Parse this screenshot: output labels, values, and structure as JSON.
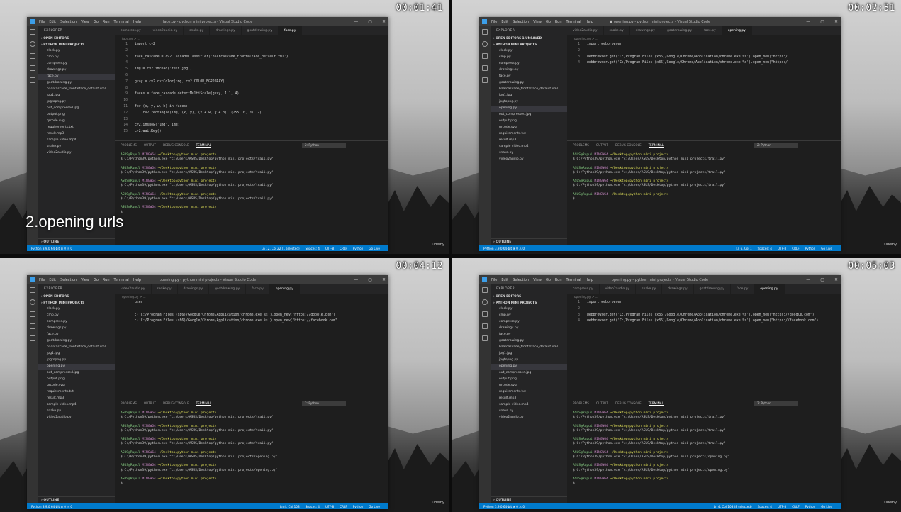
{
  "quads": [
    {
      "timestamp": "00:01:41",
      "caption": "2.opening urls",
      "window_title": "face.py - python mini projects - Visual Studio Code",
      "menu": [
        "File",
        "Edit",
        "Selection",
        "View",
        "Go",
        "Run",
        "Terminal",
        "Help"
      ],
      "explorer": "EXPLORER",
      "sections": [
        "OPEN EDITORS",
        "PYTHON MINI PROJECTS"
      ],
      "files": [
        "clock.py",
        "cmp.py",
        "compress.py",
        "drawings.py",
        "face.py",
        "goatdrawing.py",
        "haarcascade_frontalface_default.xml",
        "jpg1.jpg",
        "jpgtopng.py",
        "out_compressed.jpg",
        "output.png",
        "qrcode.svg",
        "requirements.txt",
        "result.mp3",
        "sample video.mp4",
        "snake.py",
        "video2audio.py"
      ],
      "selected": "face.py",
      "tabs": [
        "compress.py",
        "video2audio.py",
        "snake.py",
        "drawings.py",
        "goatdrawing.py",
        "face.py"
      ],
      "active_tab": "face.py",
      "crumb": "face.py > ...",
      "code": [
        [
          "1",
          "import cv2"
        ],
        [
          "2",
          ""
        ],
        [
          "3",
          "face_cascade = cv2.CascadeClassifier('haarcascade_frontalface_default.xml')"
        ],
        [
          "4",
          ""
        ],
        [
          "5",
          "img = cv2.imread('test.jpg')"
        ],
        [
          "6",
          ""
        ],
        [
          "7",
          "gray = cv2.cvtColor(img, cv2.COLOR_BGR2GRAY)"
        ],
        [
          "8",
          ""
        ],
        [
          "9",
          "faces = face_cascade.detectMultiScale(gray, 1.1, 4)"
        ],
        [
          "10",
          ""
        ],
        [
          "11",
          "for (x, y, w, h) in faces:"
        ],
        [
          "12",
          "    cv2.rectangle(img, (x, y), (x + w, y + h), (255, 0, 0), 2)"
        ],
        [
          "13",
          ""
        ],
        [
          "14",
          "cv2.imshow('img', img)"
        ],
        [
          "15",
          "cv2.waitKey()"
        ]
      ],
      "panel_tabs": [
        "PROBLEMS",
        "OUTPUT",
        "DEBUG CONSOLE",
        "TERMINAL"
      ],
      "terminal_select": "2: Python",
      "terminal": [
        [
          "ASUS@Rupul MINGW64 ~/Desktop/python mini projects",
          "$ C:/Python39/python.exe \"c:/Users/ASUS/Desktop/python mini projects/trail.py\""
        ],
        [
          "ASUS@Rupul MINGW64 ~/Desktop/python mini projects",
          "$ C:/Python39/python.exe \"c:/Users/ASUS/Desktop/python mini projects/trail.py\""
        ],
        [
          "ASUS@Rupul MINGW64 ~/Desktop/python mini projects",
          "$ C:/Python39/python.exe \"c:/Users/ASUS/Desktop/python mini projects/trail.py\""
        ],
        [
          "ASUS@Rupul MINGW64 ~/Desktop/python mini projects",
          "$ C:/Python39/python.exe \"c:/Users/ASUS/Desktop/python mini projects/trail.py\""
        ],
        [
          "ASUS@Rupul MINGW64 ~/Desktop/python mini projects",
          "$ "
        ]
      ],
      "status_left": "Python 3.9.0 64-bit  ⊗ 0 ⚠ 0",
      "status_right": [
        "Ln 12, Col 22 (1 selected)",
        "Spaces: 4",
        "UTF-8",
        "CRLF",
        "Python",
        "Go Live"
      ],
      "outline": "OUTLINE"
    },
    {
      "timestamp": "00:02:31",
      "caption": "",
      "window_title": "● opening.py - python mini projects - Visual Studio Code",
      "menu": [
        "File",
        "Edit",
        "Selection",
        "View",
        "Go",
        "Run",
        "Terminal",
        "Help"
      ],
      "explorer": "EXPLORER",
      "sections": [
        "OPEN EDITORS  1 UNSAVED",
        "PYTHON MINI PROJECTS"
      ],
      "files": [
        "clock.py",
        "cmp.py",
        "compress.py",
        "drawings.py",
        "face.py",
        "goatdrawing.py",
        "haarcascade_frontalface_default.xml",
        "jpg1.jpg",
        "jpgtopng.py",
        "opening.py",
        "out_compressed.jpg",
        "output.png",
        "qrcode.svg",
        "requirements.txt",
        "result.mp3",
        "sample video.mp4",
        "snake.py",
        "video2audio.py"
      ],
      "selected": "opening.py",
      "tabs": [
        "video2audio.py",
        "snake.py",
        "drawings.py",
        "goatdrawing.py",
        "face.py",
        "opening.py"
      ],
      "active_tab": "opening.py",
      "crumb": "opening.py > ...",
      "code": [
        [
          "1",
          "import webbrowser"
        ],
        [
          "2",
          ""
        ],
        [
          "3",
          "webbrowser.get('C:/Program Files (x86)/Google/Chrome/Application/chrome.exe %s').open_new(\"https:/"
        ],
        [
          "4",
          "webbrowser.get('C:/Program Files (x86)/Google/Chrome/Application/chrome.exe %s').open_new(\"https:/"
        ]
      ],
      "panel_tabs": [
        "PROBLEMS",
        "OUTPUT",
        "DEBUG CONSOLE",
        "TERMINAL"
      ],
      "terminal_select": "2: Python",
      "terminal": [
        [
          "ASUS@Rupul MINGW64 ~/Desktop/python mini projects",
          "$ C:/Python39/python.exe \"c:/Users/ASUS/Desktop/python mini projects/trail.py\""
        ],
        [
          "ASUS@Rupul MINGW64 ~/Desktop/python mini projects",
          "$ C:/Python39/python.exe \"c:/Users/ASUS/Desktop/python mini projects/trail.py\""
        ],
        [
          "ASUS@Rupul MINGW64 ~/Desktop/python mini projects",
          "$ C:/Python39/python.exe \"c:/Users/ASUS/Desktop/python mini projects/trail.py\""
        ],
        [
          "ASUS@Rupul MINGW64 ~/Desktop/python mini projects",
          "$ "
        ]
      ],
      "status_left": "Python 3.9.0 64-bit  ⊗ 0 ⚠ 0",
      "status_right": [
        "Ln 6, Col 1",
        "Spaces: 4",
        "UTF-8",
        "CRLF",
        "Python",
        "Go Live"
      ],
      "outline": "OUTLINE"
    },
    {
      "timestamp": "00:04:12",
      "caption": "",
      "window_title": "opening.py - python mini projects - Visual Studio Code",
      "menu": [
        "File",
        "Edit",
        "Selection",
        "View",
        "Go",
        "Run",
        "Terminal",
        "Help"
      ],
      "explorer": "EXPLORER",
      "sections": [
        "OPEN EDITORS",
        "PYTHON MINI PROJECTS"
      ],
      "files": [
        "clock.py",
        "cmp.py",
        "compress.py",
        "drawings.py",
        "face.py",
        "goatdrawing.py",
        "haarcascade_frontalface_default.xml",
        "jpg1.jpg",
        "jpgtopng.py",
        "opening.py",
        "out_compressed.jpg",
        "output.png",
        "qrcode.svg",
        "requirements.txt",
        "result.mp3",
        "sample video.mp4",
        "snake.py",
        "video2audio.py"
      ],
      "selected": "opening.py",
      "tabs": [
        "video2audio.py",
        "snake.py",
        "drawings.py",
        "goatdrawing.py",
        "face.py",
        "opening.py"
      ],
      "active_tab": "opening.py",
      "crumb": "opening.py > ...",
      "code": [
        [
          "",
          "user"
        ],
        [
          "",
          ""
        ],
        [
          "",
          ":('C:/Program Files (x86)/Google/Chrome/Application/chrome.exe %s').open_new(\"https://google.com\")"
        ],
        [
          "",
          ":('C:/Program Files (x86)/Google/Chrome/Application/chrome.exe %s').open_new(\"https://facebook.com\""
        ]
      ],
      "panel_tabs": [
        "PROBLEMS",
        "OUTPUT",
        "DEBUG CONSOLE",
        "TERMINAL"
      ],
      "terminal_select": "2: Python",
      "terminal": [
        [
          "ASUS@Rupul MINGW64 ~/Desktop/python mini projects",
          "$ C:/Python39/python.exe \"c:/Users/ASUS/Desktop/python mini projects/trail.py\""
        ],
        [
          "ASUS@Rupul MINGW64 ~/Desktop/python mini projects",
          "$ C:/Python39/python.exe \"c:/Users/ASUS/Desktop/python mini projects/trail.py\""
        ],
        [
          "ASUS@Rupul MINGW64 ~/Desktop/python mini projects",
          "$ C:/Python39/python.exe \"c:/Users/ASUS/Desktop/python mini projects/trail.py\""
        ],
        [
          "ASUS@Rupul MINGW64 ~/Desktop/python mini projects",
          "$ C:/Python39/python.exe \"c:/Users/ASUS/Desktop/python mini projects/opening.py\""
        ],
        [
          "ASUS@Rupul MINGW64 ~/Desktop/python mini projects",
          "$ C:/Python39/python.exe \"c:/Users/ASUS/Desktop/python mini projects/opening.py\""
        ],
        [
          "ASUS@Rupul MINGW64 ~/Desktop/python mini projects",
          "$ "
        ]
      ],
      "status_left": "Python 3.9.0 64-bit  ⊗ 0 ⚠ 0",
      "status_right": [
        "Ln 4, Col 108",
        "Spaces: 4",
        "UTF-8",
        "CRLF",
        "Python",
        "Go Live"
      ],
      "outline": "OUTLINE"
    },
    {
      "timestamp": "00:05:03",
      "caption": "",
      "window_title": "opening.py - python mini projects - Visual Studio Code",
      "menu": [
        "File",
        "Edit",
        "Selection",
        "View",
        "Go",
        "Run",
        "Terminal",
        "Help"
      ],
      "explorer": "EXPLORER",
      "sections": [
        "OPEN EDITORS",
        "PYTHON MINI PROJECTS"
      ],
      "files": [
        "clock.py",
        "cmp.py",
        "compress.py",
        "drawings.py",
        "face.py",
        "goatdrawing.py",
        "haarcascade_frontalface_default.xml",
        "jpg1.jpg",
        "jpgtopng.py",
        "opening.py",
        "out_compressed.jpg",
        "output.png",
        "qrcode.svg",
        "requirements.txt",
        "result.mp3",
        "sample video.mp4",
        "snake.py",
        "video2audio.py"
      ],
      "selected": "opening.py",
      "tabs": [
        "compress.py",
        "video2audio.py",
        "snake.py",
        "drawings.py",
        "goatdrawing.py",
        "face.py",
        "opening.py"
      ],
      "active_tab": "opening.py",
      "crumb": "opening.py > ...",
      "code": [
        [
          "1",
          "import webbrowser"
        ],
        [
          "2",
          ""
        ],
        [
          "3",
          "webbrowser.get('C:/Program Files (x86)/Google/Chrome/Application/chrome.exe %s').open_new(\"https://google.com\")"
        ],
        [
          "4",
          "webbrowser.get('C:/Program Files (x86)/Google/Chrome/Application/chrome.exe %s').open_new(\"https://facebook.com\")"
        ]
      ],
      "panel_tabs": [
        "PROBLEMS",
        "OUTPUT",
        "DEBUG CONSOLE",
        "TERMINAL"
      ],
      "terminal_select": "2: Python",
      "terminal": [
        [
          "ASUS@Rupul MINGW64 ~/Desktop/python mini projects",
          "$ C:/Python39/python.exe \"c:/Users/ASUS/Desktop/python mini projects/trail.py\""
        ],
        [
          "ASUS@Rupul MINGW64 ~/Desktop/python mini projects",
          "$ C:/Python39/python.exe \"c:/Users/ASUS/Desktop/python mini projects/trail.py\""
        ],
        [
          "ASUS@Rupul MINGW64 ~/Desktop/python mini projects",
          "$ C:/Python39/python.exe \"c:/Users/ASUS/Desktop/python mini projects/trail.py\""
        ],
        [
          "ASUS@Rupul MINGW64 ~/Desktop/python mini projects",
          "$ C:/Python39/python.exe \"c:/Users/ASUS/Desktop/python mini projects/opening.py\""
        ],
        [
          "ASUS@Rupul MINGW64 ~/Desktop/python mini projects",
          "$ C:/Python39/python.exe \"c:/Users/ASUS/Desktop/python mini projects/opening.py\""
        ],
        [
          "ASUS@Rupul MINGW64 ~/Desktop/python mini projects",
          "$ "
        ]
      ],
      "status_left": "Python 3.9.0 64-bit  ⊗ 0 ⚠ 0",
      "status_right": [
        "Ln 4, Col 108 (8 selected)",
        "Spaces: 4",
        "UTF-8",
        "CRLF",
        "Python",
        "Go Live"
      ],
      "outline": "OUTLINE"
    }
  ],
  "brand": "Udemy"
}
